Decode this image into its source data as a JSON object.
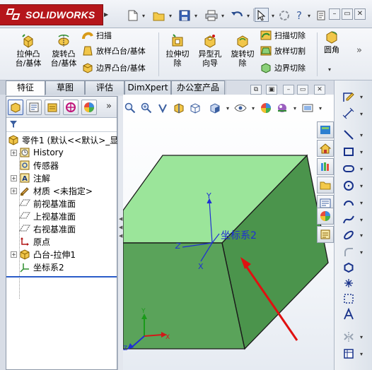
{
  "app": {
    "brand": "SOLIDWORKS"
  },
  "ribbon": {
    "extrude_boss": "拉伸凸\n台/基体",
    "revolve_boss": "旋转凸\n台/基体",
    "sweep": "扫描",
    "loft_boss": "放样凸台/基体",
    "boundary_boss": "边界凸台/基体",
    "extrude_cut": "拉伸切\n除",
    "hole_wizard": "异型孔\n向导",
    "revolve_cut": "旋转切\n除",
    "swept_cut": "扫描切除",
    "lofted_cut": "放样切割",
    "boundary_cut": "边界切除",
    "fillet": "圆角",
    "more": "»"
  },
  "tabs": [
    {
      "label": "特征",
      "active": true
    },
    {
      "label": "草图"
    },
    {
      "label": "评估"
    },
    {
      "label": "DimXpert"
    },
    {
      "label": "办公室产品"
    }
  ],
  "feature_manager": {
    "panel_more": "»",
    "tree": [
      {
        "label": "零件1 (默认<<默认>_显",
        "icon": "part-icon"
      },
      {
        "label": "History",
        "icon": "history-icon",
        "expandable": true
      },
      {
        "label": "传感器",
        "icon": "sensor-icon"
      },
      {
        "label": "注解",
        "icon": "annotation-icon",
        "expandable": true
      },
      {
        "label": "材质 <未指定>",
        "icon": "material-icon",
        "expandable": true
      },
      {
        "label": "前视基准面",
        "icon": "plane-icon"
      },
      {
        "label": "上视基准面",
        "icon": "plane-icon"
      },
      {
        "label": "右视基准面",
        "icon": "plane-icon"
      },
      {
        "label": "原点",
        "icon": "origin-icon"
      },
      {
        "label": "凸台-拉伸1",
        "icon": "extrude-feature-icon",
        "expandable": true
      },
      {
        "label": "坐标系2",
        "icon": "coordinate-system-icon"
      }
    ]
  },
  "graphics": {
    "coord_label": "坐标系2",
    "axis_x": "X",
    "axis_y": "Y",
    "axis_z": "Z",
    "triad_x": "X",
    "triad_y": "Y",
    "triad_z": "Z",
    "colors": {
      "top_face": "#9be59a",
      "front_face": "#5aa35a",
      "side_face": "#4b944c",
      "edge": "#1b1b1b",
      "coord_axes": "#1f2fd4",
      "arrow": "#e01010"
    }
  }
}
